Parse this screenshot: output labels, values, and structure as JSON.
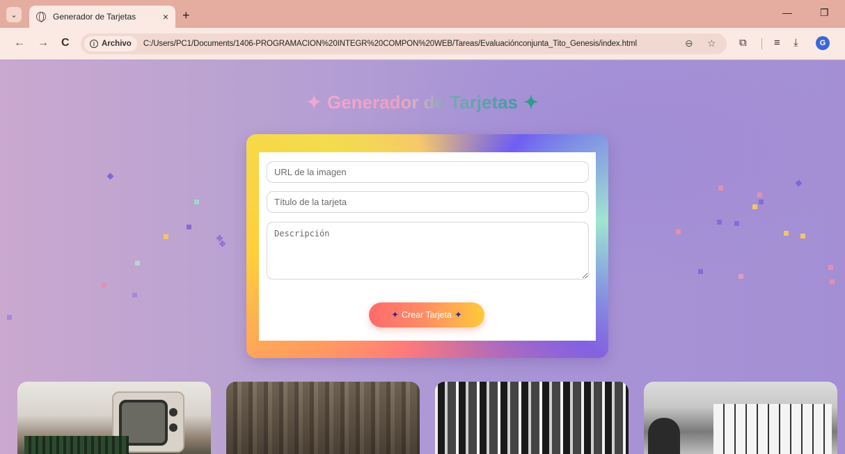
{
  "browser": {
    "tab_title": "Generador de Tarjetas",
    "tab_close": "×",
    "new_tab": "+",
    "menu_glyph": "⌄",
    "back": "←",
    "forward": "→",
    "reload": "C",
    "security_chip": "Archivo",
    "security_info": "i",
    "url": "C:/Users/PC1/Documents/1406-PROGRAMACIÓN%20INTEGR%20COMPON%20WEB/Tareas/Evaluaciónconjunta_Tito_Genesis/index.html",
    "zoom_icon": "⊖",
    "bookmark_icon": "☆",
    "extensions_icon": "⧉",
    "reading_icon": "≡",
    "download_icon": "⤓",
    "profile_letter": "G",
    "minimize": "—",
    "restore": "❐"
  },
  "page": {
    "heading_left_star": "✦",
    "heading": "Generador de Tarjetas",
    "heading_right_star": "✦",
    "form": {
      "image_url_placeholder": "URL de la imagen",
      "title_placeholder": "Título de la tarjeta",
      "description_placeholder": "Descripción",
      "submit_label": "Crear Tarjeta",
      "submit_left_spark": "✦",
      "submit_right_spark": "✦"
    },
    "cards": [
      {
        "image": "vintage-tv-computer"
      },
      {
        "image": "mechanical-computer"
      },
      {
        "image": "mainframe-racks"
      },
      {
        "image": "control-panel-operator"
      }
    ]
  },
  "colors": {
    "tabbar": "#e4ad9f",
    "toolbar": "#fbe9e3",
    "button_gradient_start": "#ff6b6b",
    "button_gradient_end": "#ffc93a",
    "heading_pink": "#f3a6d4",
    "heading_teal": "#2b9c8e"
  }
}
